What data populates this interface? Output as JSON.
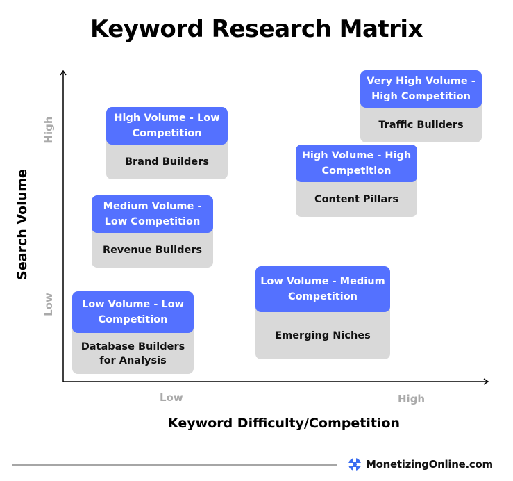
{
  "title": "Keyword Research Matrix",
  "axes": {
    "x_label": "Keyword Difficulty/Competition",
    "y_label": "Search Volume",
    "x_ticks": [
      "Low",
      "High"
    ],
    "y_ticks": [
      "High",
      "Low"
    ]
  },
  "cards": [
    {
      "heading": "High Volume - Low Competition",
      "label": "Brand Builders"
    },
    {
      "heading": "Medium Volume - Low Competition",
      "label": "Revenue Builders"
    },
    {
      "heading": "Low Volume - Low Competition",
      "label": "Database Builders for Analysis"
    },
    {
      "heading": "Low Volume - Medium Competition",
      "label": "Emerging Niches"
    },
    {
      "heading": "High Volume - High Competition",
      "label": "Content Pillars"
    },
    {
      "heading": "Very High Volume - High Competition",
      "label": "Traffic Builders"
    }
  ],
  "footer": {
    "brand": "MonetizingOnline.com",
    "logo_icon": "monetizing-online-logo-icon"
  },
  "colors": {
    "heading_bg": "#5471ff",
    "card_bg": "#d9d9d9",
    "tick_text": "#aaaaaa"
  }
}
